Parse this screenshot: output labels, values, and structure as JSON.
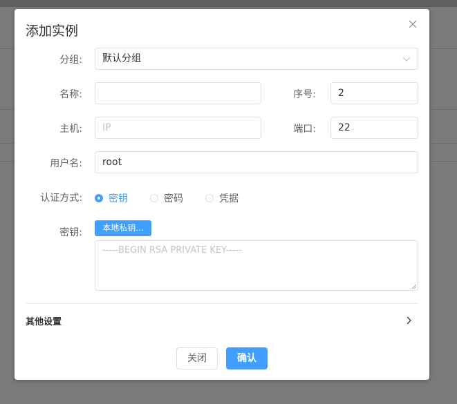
{
  "dialog": {
    "title": "添加实例",
    "close_icon": "close-icon"
  },
  "form": {
    "group": {
      "label": "分组:",
      "value": "默认分组"
    },
    "name": {
      "label": "名称:",
      "value": ""
    },
    "order": {
      "label": "序号:",
      "value": "2"
    },
    "host": {
      "label": "主机:",
      "placeholder": "IP",
      "value": ""
    },
    "port": {
      "label": "端口:",
      "value": "22"
    },
    "username": {
      "label": "用户名:",
      "value": "root"
    },
    "auth": {
      "label": "认证方式:",
      "options": [
        {
          "label": "密钥",
          "checked": true
        },
        {
          "label": "密码",
          "checked": false
        },
        {
          "label": "凭据",
          "checked": false
        }
      ]
    },
    "key": {
      "label": "密钥:",
      "upload_label": "本地私钥...",
      "placeholder": "-----BEGIN RSA PRIVATE KEY-----"
    }
  },
  "other_settings": {
    "label": "其他设置"
  },
  "footer": {
    "close_label": "关闭",
    "confirm_label": "确认"
  },
  "colors": {
    "accent": "#409eff",
    "border": "#dcdfe6",
    "text": "#606266"
  }
}
